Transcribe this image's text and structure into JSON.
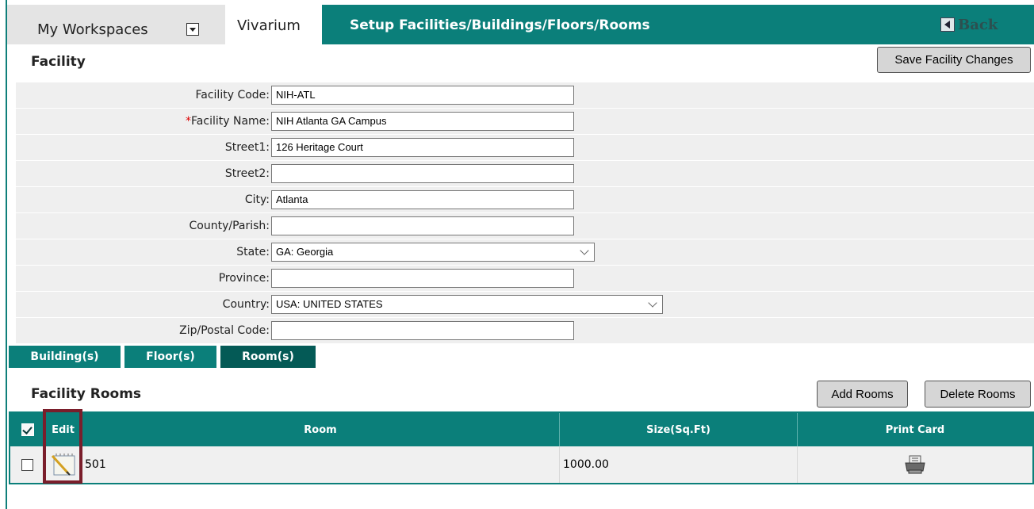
{
  "header": {
    "workspaces_label": "My Workspaces",
    "vivarium_label": "Vivarium",
    "page_title": "Setup Facilities/Buildings/Floors/Rooms",
    "back_label": "Back"
  },
  "facility": {
    "title": "Facility",
    "save_button": "Save Facility Changes",
    "fields": {
      "code": {
        "label": "Facility Code:",
        "value": "NIH-ATL"
      },
      "name": {
        "required_mark": "*",
        "label": "Facility Name:",
        "value": "NIH Atlanta GA Campus"
      },
      "street1": {
        "label": "Street1:",
        "value": "126 Heritage Court"
      },
      "street2": {
        "label": "Street2:",
        "value": ""
      },
      "city": {
        "label": "City:",
        "value": "Atlanta"
      },
      "county": {
        "label": "County/Parish:",
        "value": ""
      },
      "state": {
        "label": "State:",
        "value": "GA: Georgia"
      },
      "province": {
        "label": "Province:",
        "value": ""
      },
      "country": {
        "label": "Country:",
        "value": "USA: UNITED STATES"
      },
      "zip": {
        "label": "Zip/Postal Code:",
        "value": ""
      }
    }
  },
  "subtabs": {
    "buildings": "Building(s)",
    "floors": "Floor(s)",
    "rooms": "Room(s)",
    "active": "rooms"
  },
  "rooms": {
    "title": "Facility Rooms",
    "add_button": "Add Rooms",
    "delete_button": "Delete Rooms",
    "columns": {
      "edit": "Edit",
      "room": "Room",
      "size": "Size(Sq.Ft)",
      "print": "Print Card"
    },
    "rows": [
      {
        "room": "501",
        "size": "1000.00"
      }
    ]
  },
  "colors": {
    "accent": "#0b7f7a",
    "active_tab": "#045a56",
    "highlight_box": "#7a1e2b",
    "required": "#dd0000"
  }
}
